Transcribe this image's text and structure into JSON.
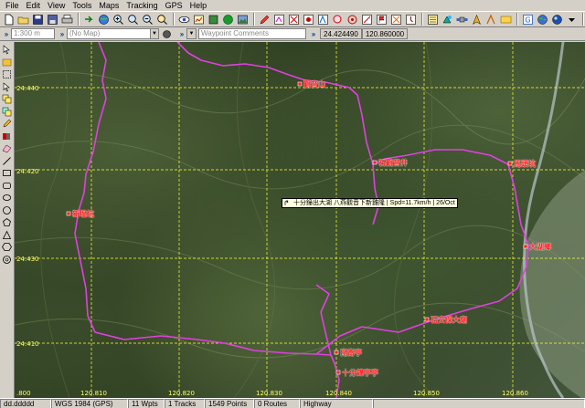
{
  "menu": [
    "File",
    "Edit",
    "View",
    "Tools",
    "Maps",
    "Tracking",
    "GPS",
    "Help"
  ],
  "toolbar_icons": [
    "new-file",
    "open-folder",
    "save",
    "save-as",
    "print",
    "import",
    "globe",
    "zoom-in",
    "zoom-in-rect",
    "zoom-out",
    "zoom-fit",
    "eye",
    "chart",
    "layer",
    "green-globe",
    "map-photo",
    "tool-a",
    "tool-b",
    "tool-c",
    "tool-d",
    "tool-e",
    "tool-f",
    "tool-g",
    "tool-h",
    "tool-i",
    "tool-j",
    "tool-k",
    "tool-l",
    "tool-m",
    "tool-n",
    "tool-o",
    "tool-p",
    "tool-q",
    "tool-r",
    "tool-s",
    "tool-t",
    "help-question"
  ],
  "options": {
    "scale": "1:300 m",
    "map_name": "(No Map)",
    "waypoint_comments": "Waypoint Comments",
    "latitude": "24.424490",
    "longitude": "120.860000"
  },
  "grid": {
    "lat_labels": [
      "24.440",
      "24.430",
      "24.420",
      "24.410"
    ],
    "lon_labels": [
      "120.810",
      "120.820",
      "120.830",
      "120.840",
      "120.850",
      "120.860"
    ],
    "edge_label": ".800"
  },
  "waypoints": [
    {
      "label": "觀音山"
    },
    {
      "label": "石觀音井"
    },
    {
      "label": "馬頭坑"
    },
    {
      "label": "新塭坑"
    },
    {
      "label": "大湖鄉"
    },
    {
      "label": "石交保大廟"
    },
    {
      "label": "崑崙亭"
    },
    {
      "label": "十分鐘亭亭"
    }
  ],
  "tooltip": "十分鐘出大湖  八燕觀音下新雞隆 | Spd=11.7km/h | 26/Oct",
  "status": {
    "file": "dd.ddddd",
    "datum": "WGS 1984 (GPS)",
    "waypoints": "11 Wpts",
    "tracks": "1 Tracks",
    "points": "1549 Points",
    "routes": "0 Routes",
    "road": "Highway"
  },
  "colors": {
    "track": "#e040e0",
    "grid": "#ffff33",
    "waypoint": "#ff2020"
  }
}
